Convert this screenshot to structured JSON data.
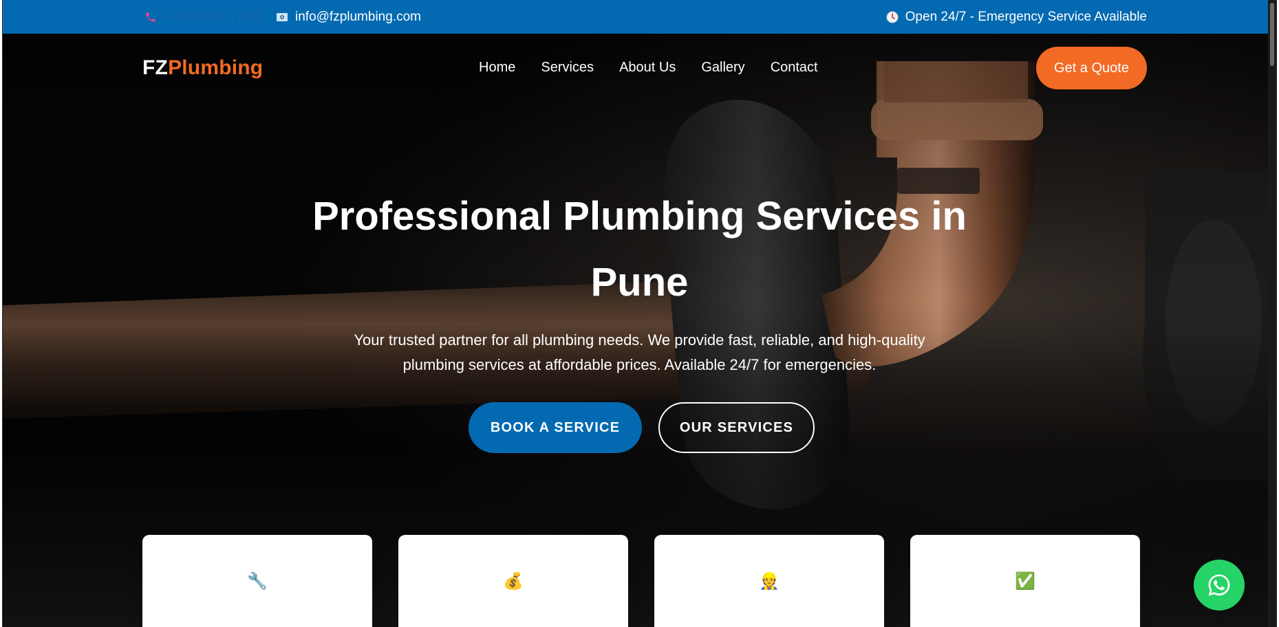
{
  "topbar": {
    "phone": "+91 87931 72747",
    "email": "info@fzplumbing.com",
    "hours": "Open 24/7 - Emergency Service Available"
  },
  "nav": {
    "logo_part1": "FZ",
    "logo_part2": "Plumbing",
    "items": [
      "Home",
      "Services",
      "About Us",
      "Gallery",
      "Contact"
    ],
    "cta": "Get a Quote"
  },
  "hero": {
    "title_line1": "Professional Plumbing Services in",
    "title_line2": "Pune",
    "subtitle_line1": "Your trusted partner for all plumbing needs. We provide fast, reliable, and high-quality",
    "subtitle_line2": "plumbing services at affordable prices. Available 24/7 for emergencies.",
    "primary_button": "BOOK A SERVICE",
    "secondary_button": "OUR SERVICES"
  },
  "feature_cards": [
    {
      "icon": "🔧",
      "icon_name": "wrench-icon"
    },
    {
      "icon": "💰",
      "icon_name": "money-bag-icon"
    },
    {
      "icon": "👷",
      "icon_name": "worker-icon"
    },
    {
      "icon": "✅",
      "icon_name": "check-mark-icon"
    }
  ],
  "colors": {
    "topbar_bg": "#0369b1",
    "accent_orange": "#f26a24",
    "primary_blue": "#0369b1",
    "whatsapp_green": "#25d366"
  }
}
